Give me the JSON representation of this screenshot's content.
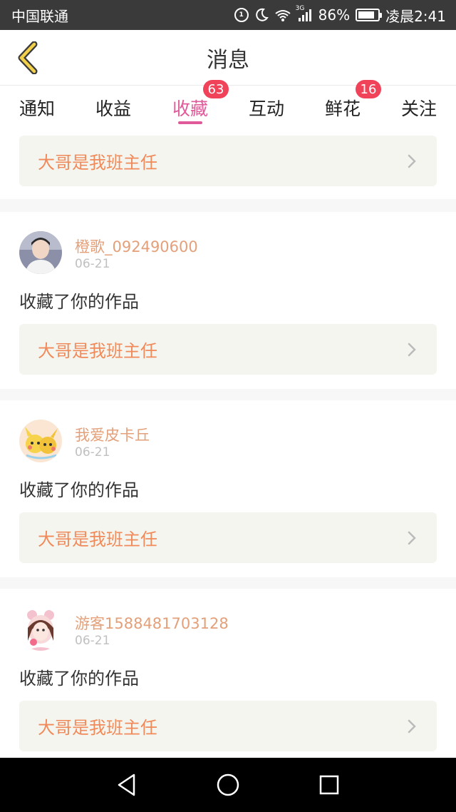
{
  "status_bar": {
    "carrier": "中国联通",
    "network": "3G",
    "battery": "86%",
    "battery_level": 0.86,
    "time": "凌晨2:41"
  },
  "header": {
    "title": "消息"
  },
  "tabs": [
    {
      "label": "通知",
      "active": false,
      "badge": ""
    },
    {
      "label": "收益",
      "active": false,
      "badge": ""
    },
    {
      "label": "收藏",
      "active": true,
      "badge": "63"
    },
    {
      "label": "互动",
      "active": false,
      "badge": ""
    },
    {
      "label": "鲜花",
      "active": false,
      "badge": "16"
    },
    {
      "label": "关注",
      "active": false,
      "badge": ""
    }
  ],
  "feed": {
    "partial_item": {
      "work_title": "大哥是我班主任"
    },
    "items": [
      {
        "username": "橙歌_092490600",
        "date": "06-21",
        "action": "收藏了你的作品",
        "work_title": "大哥是我班主任"
      },
      {
        "username": "我爱皮卡丘",
        "date": "06-21",
        "action": "收藏了你的作品",
        "work_title": "大哥是我班主任"
      },
      {
        "username": "游客1588481703128",
        "date": "06-21",
        "action": "收藏了你的作品",
        "work_title": "大哥是我班主任"
      }
    ]
  },
  "colors": {
    "accent": "#e05a9a",
    "badge": "#f0435a",
    "username": "#e3a07a",
    "work_title": "#f08a5a",
    "back_arrow": "#f2d04a"
  }
}
